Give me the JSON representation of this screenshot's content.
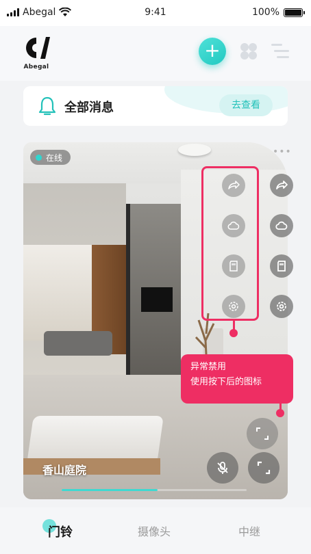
{
  "status_bar": {
    "carrier": "Abegal",
    "time": "9:41",
    "battery": "100%"
  },
  "header": {
    "logo_text": "Abegal",
    "add_symbol": "+"
  },
  "messages": {
    "title": "全部消息",
    "view_button": "去查看"
  },
  "camera": {
    "status": "在线",
    "location_name": "香山庭院",
    "more": "•••",
    "tooltip": {
      "line1": "异常禁用",
      "line2": "使用按下后的图标"
    },
    "progress": 0.52
  },
  "tabs": [
    {
      "label": "门铃",
      "active": true
    },
    {
      "label": "摄像头",
      "active": false
    },
    {
      "label": "中继",
      "active": false
    }
  ],
  "colors": {
    "accent": "#2fd6cf",
    "alert": "#ee2e63"
  }
}
